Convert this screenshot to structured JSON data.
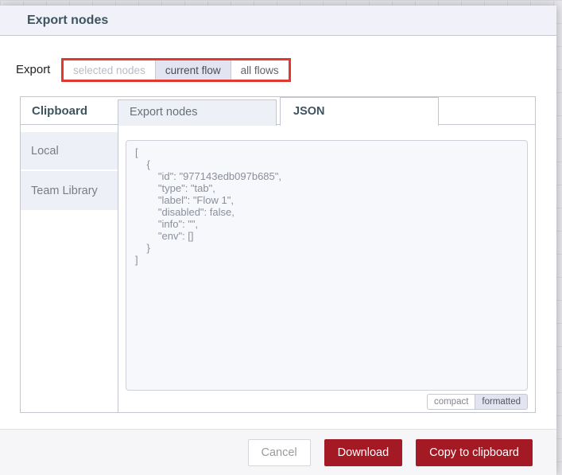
{
  "dialog": {
    "title": "Export nodes"
  },
  "export_row": {
    "label": "Export",
    "options": [
      {
        "label": "selected nodes",
        "state": "disabled"
      },
      {
        "label": "current flow",
        "state": "selected"
      },
      {
        "label": "all flows",
        "state": "normal"
      }
    ]
  },
  "library": {
    "header": "Clipboard",
    "tabs": [
      {
        "label": "Export nodes",
        "active": false
      },
      {
        "label": "JSON",
        "active": true
      }
    ],
    "sidebar_items": [
      {
        "label": "Local"
      },
      {
        "label": "Team Library"
      }
    ]
  },
  "code": {
    "content": "[\n    {\n        \"id\": \"977143edb097b685\",\n        \"type\": \"tab\",\n        \"label\": \"Flow 1\",\n        \"disabled\": false,\n        \"info\": \"\",\n        \"env\": []\n    }\n]",
    "format_toggle": [
      {
        "label": "compact",
        "selected": false
      },
      {
        "label": "formatted",
        "selected": true
      }
    ]
  },
  "footer": {
    "buttons": [
      {
        "label": "Cancel",
        "style": "secondary"
      },
      {
        "label": "Download",
        "style": "primary"
      },
      {
        "label": "Copy to clipboard",
        "style": "primary"
      }
    ]
  },
  "colors": {
    "primary_button": "#a31a24",
    "annotation_highlight": "#e0392f",
    "selection_bg": "#e2e4f1",
    "header_bg": "#f0f1f9",
    "title_text": "#3e545f"
  }
}
